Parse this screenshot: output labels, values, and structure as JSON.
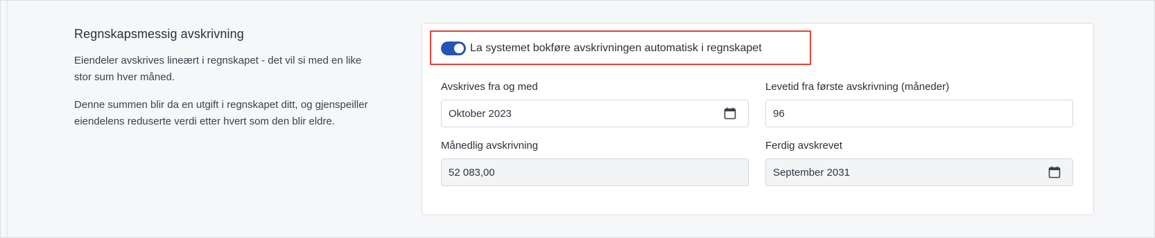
{
  "section": {
    "title": "Regnskapsmessig avskrivning",
    "paragraph1": "Eiendeler avskrives lineært i regnskapet - det vil si med en like stor sum hver måned.",
    "paragraph2": "Denne summen blir da en utgift i regnskapet ditt, og gjenspeiller eiendelens reduserte verdi etter hvert som den blir eldre."
  },
  "toggle": {
    "label": "La systemet bokføre avskrivningen automatisk i regnskapet",
    "checked": true,
    "color": "#2554b4"
  },
  "fields": {
    "start": {
      "label": "Avskrives fra og med",
      "value": "Oktober 2023",
      "icon": "calendar-icon"
    },
    "lifetime": {
      "label": "Levetid fra første avskrivning (måneder)",
      "value": "96"
    },
    "monthly": {
      "label": "Månedlig avskrivning",
      "value": "52 083,00"
    },
    "finished": {
      "label": "Ferdig avskrevet",
      "value": "September 2031",
      "icon": "calendar-icon"
    }
  },
  "highlight_color": "#e24234"
}
